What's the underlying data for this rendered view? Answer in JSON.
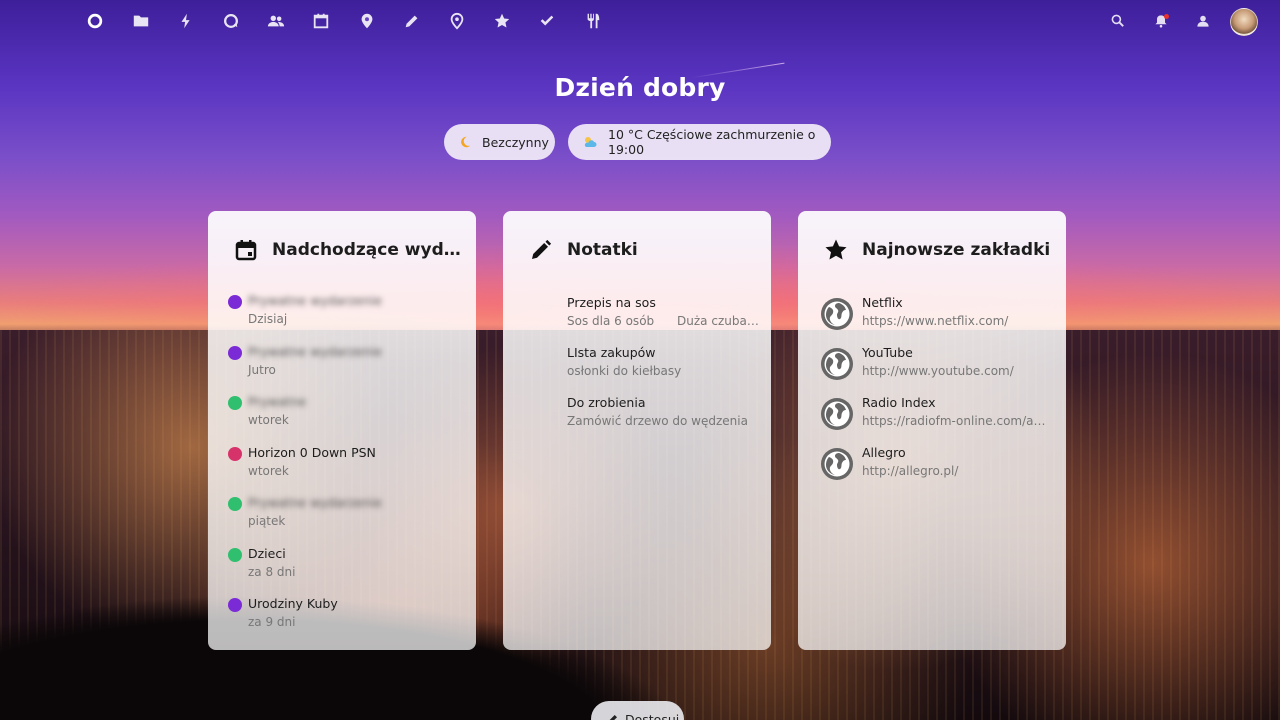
{
  "nav": {
    "items": [
      {
        "name": "dashboard",
        "icon": "nextcloud-logo-icon"
      },
      {
        "name": "files",
        "icon": "folder-icon"
      },
      {
        "name": "activity",
        "icon": "lightning-icon"
      },
      {
        "name": "talk",
        "icon": "chat-icon"
      },
      {
        "name": "contacts",
        "icon": "contacts-icon"
      },
      {
        "name": "calendar",
        "icon": "calendar-icon"
      },
      {
        "name": "maps",
        "icon": "map-pin-icon"
      },
      {
        "name": "notes",
        "icon": "pencil-icon"
      },
      {
        "name": "phonetrack",
        "icon": "location-icon"
      },
      {
        "name": "bookmarks",
        "icon": "star-icon"
      },
      {
        "name": "tasks",
        "icon": "checkmark-icon"
      },
      {
        "name": "cookbook",
        "icon": "cutlery-icon"
      }
    ],
    "right": [
      "search-icon",
      "bell-icon",
      "contacts-menu-icon",
      "avatar"
    ]
  },
  "greeting": "Dzień dobry",
  "status": {
    "label": "Bezczynny",
    "icon": "moon-icon"
  },
  "weather": {
    "label": "10 °C Częściowe zachmurzenie o 19:00",
    "icon": "partly-cloudy-icon"
  },
  "widgets": {
    "calendar": {
      "title": "Nadchodzące wydarz…",
      "events": [
        {
          "title": "Prywatne wydarzenie",
          "when": "Dzisiaj",
          "color": "#7b2bd6",
          "blurred": true
        },
        {
          "title": "Prywatne wydarzenie",
          "when": "Jutro",
          "color": "#7b2bd6",
          "blurred": true
        },
        {
          "title": "Prywatne",
          "when": "wtorek",
          "color": "#2fbf6e",
          "blurred": true
        },
        {
          "title": "Horizon 0 Down PSN",
          "when": "wtorek",
          "color": "#d6336b",
          "blurred": false
        },
        {
          "title": "Prywatne wydarzenie",
          "when": "piątek",
          "color": "#2fbf6e",
          "blurred": true
        },
        {
          "title": "Dzieci",
          "when": "za 8 dni",
          "color": "#2fbf6e",
          "blurred": false
        },
        {
          "title": "Urodziny Kuby",
          "when": "za 9 dni",
          "color": "#7b2bd6",
          "blurred": false
        }
      ]
    },
    "notes": {
      "title": "Notatki",
      "items": [
        {
          "title": "Przepis na sos",
          "excerpt": "Sos dla 6 osób      Duża czuba…"
        },
        {
          "title": "LIsta zakupów",
          "excerpt": "osłonki do kiełbasy"
        },
        {
          "title": "Do zrobienia",
          "excerpt": "Zamówić drzewo do wędzenia"
        }
      ]
    },
    "bookmarks": {
      "title": "Najnowsze zakładki",
      "items": [
        {
          "title": "Netflix",
          "url": "https://www.netflix.com/"
        },
        {
          "title": "YouTube",
          "url": "http://www.youtube.com/"
        },
        {
          "title": "Radio Index",
          "url": "https://radiofm-online.com/a…"
        },
        {
          "title": "Allegro",
          "url": "http://allegro.pl/"
        }
      ]
    }
  },
  "edit_button": {
    "label": "Dostosuj"
  }
}
